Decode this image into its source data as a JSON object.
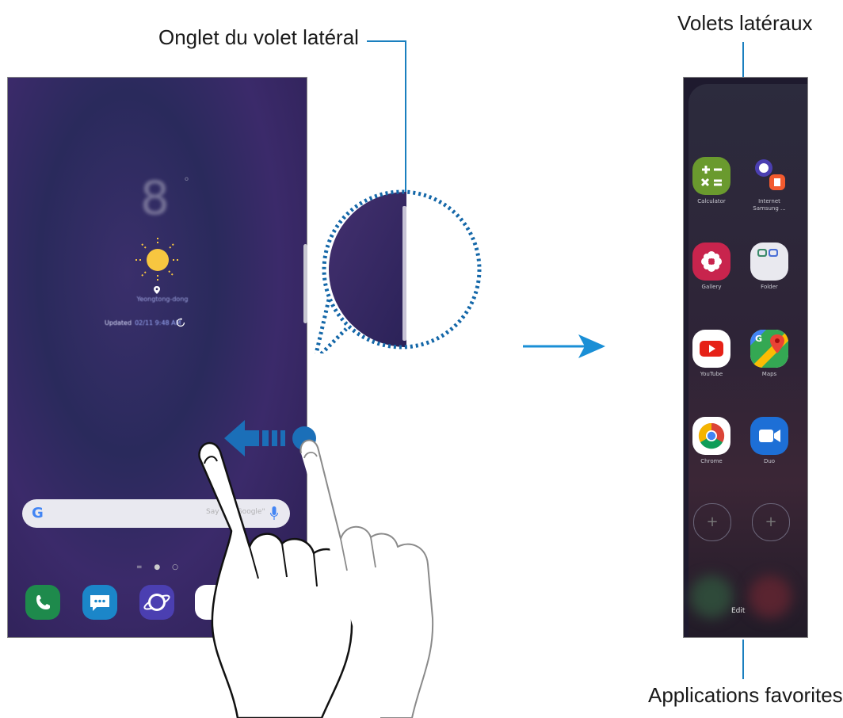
{
  "callouts": {
    "tab": "Onglet du volet latéral",
    "panels": "Volets latéraux",
    "favorites": "Applications favorites"
  },
  "home_screen": {
    "clock": "8",
    "degree": "°",
    "location": "Yeongtong-dong",
    "updated_label": "Updated",
    "updated_time": "02/11 9:48 AM",
    "search_logo": "G",
    "search_hint": "Say \"Ok Google\"",
    "page_dots": "= ● ○"
  },
  "edge_panel": {
    "apps": [
      {
        "name": "Calculator",
        "color": "#6a9a2e",
        "icon": "calculator-icon"
      },
      {
        "name": "Internet Samsung ...",
        "color": "#e8e8ee",
        "icon": "internet-notes-pair-icon"
      },
      {
        "name": "Gallery",
        "color": "#c8244d",
        "icon": "gallery-icon"
      },
      {
        "name": "Folder",
        "color": "#e9e9ef",
        "icon": "folder-icon"
      },
      {
        "name": "YouTube",
        "color": "#ffffff",
        "icon": "youtube-icon"
      },
      {
        "name": "Maps",
        "color": "#ffffff",
        "icon": "maps-icon"
      },
      {
        "name": "Chrome",
        "color": "#ffffff",
        "icon": "chrome-icon"
      },
      {
        "name": "Duo",
        "color": "#1d6fd6",
        "icon": "duo-icon"
      }
    ],
    "add_symbol": "+",
    "edit_label": "Edit"
  },
  "colors": {
    "leader": "#1a7fbf",
    "arrow": "#1a8fd6",
    "swipe_arrow": "#1b6fb8"
  }
}
